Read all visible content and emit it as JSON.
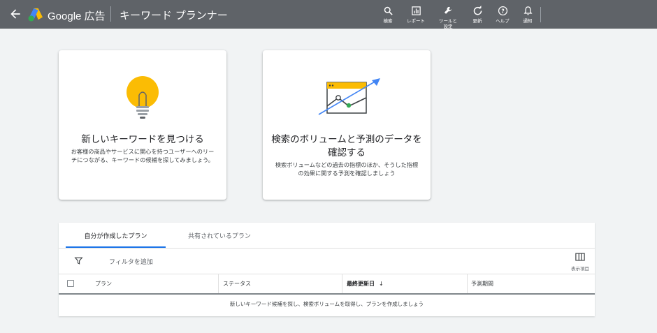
{
  "header": {
    "brand": "Google 広告",
    "title": "キーワード プランナー",
    "tools": [
      {
        "icon": "search-icon",
        "label": "検索"
      },
      {
        "icon": "report-icon",
        "label": "レポート"
      },
      {
        "icon": "wrench-icon",
        "label": "ツールと\n設定"
      },
      {
        "icon": "refresh-icon",
        "label": "更新"
      },
      {
        "icon": "help-icon",
        "label": "ヘルプ"
      },
      {
        "icon": "bell-icon",
        "label": "通知"
      }
    ]
  },
  "cards": [
    {
      "icon": "lightbulb-icon",
      "title": "新しいキーワードを見つける",
      "desc": "お客様の商品やサービスに関心を持つユーザーへのリーチにつながる、キーワードの候補を探してみましょう。"
    },
    {
      "icon": "trend-chart-icon",
      "title": "検索のボリュームと予測のデータを確認する",
      "desc": "検索ボリュームなどの過去の指標のほか、そうした指標の効果に関する予測を確認しましょう"
    }
  ],
  "plans": {
    "tabs": [
      "自分が作成したプラン",
      "共有されているプラン"
    ],
    "active_tab": 0,
    "filter_label": "フィルタを追加",
    "columns_label": "表示項目",
    "table": {
      "columns": [
        "プラン",
        "ステータス",
        "最終更新日",
        "予測期間"
      ],
      "sorted_column": "最終更新日",
      "sort_direction": "descending",
      "empty_message": "新しいキーワード候補を探し、検索ボリュームを取得し、プランを作成しましょう"
    }
  },
  "colors": {
    "topbar": "#5f6368",
    "accent": "#1a73e8",
    "bulb": "#fbbc04",
    "logo_blue": "#4285f4",
    "logo_green": "#34a853"
  }
}
